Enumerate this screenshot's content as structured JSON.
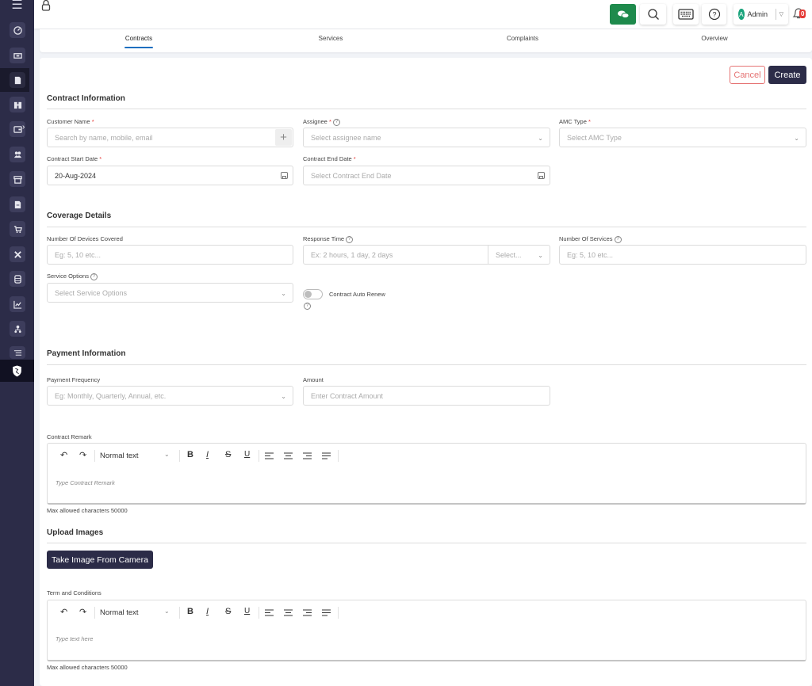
{
  "sidebar": {
    "menu_icon": "hamburger-icon",
    "items": [
      {
        "name": "dashboard",
        "icon": "gauge-icon"
      },
      {
        "name": "tickets",
        "icon": "ticket-icon"
      },
      {
        "name": "contracts",
        "icon": "document-icon",
        "active": true
      },
      {
        "name": "binoculars",
        "icon": "binoculars-icon"
      },
      {
        "name": "wallet",
        "icon": "wallet-icon",
        "has_submenu": true
      },
      {
        "name": "customers",
        "icon": "users-icon"
      },
      {
        "name": "store",
        "icon": "store-icon"
      },
      {
        "name": "invoices",
        "icon": "invoice-icon"
      },
      {
        "name": "cart",
        "icon": "cart-icon"
      },
      {
        "name": "tools",
        "icon": "tools-icon"
      },
      {
        "name": "database",
        "icon": "database-icon"
      },
      {
        "name": "reports",
        "icon": "chart-icon"
      },
      {
        "name": "hierarchy",
        "icon": "org-icon"
      },
      {
        "name": "settings-list",
        "icon": "list-icon"
      }
    ],
    "bottom_icon": "shield-icon"
  },
  "topbar": {
    "lock_icon": "lock-icon",
    "user_name": "Admin",
    "user_initial": "A",
    "notification_count": "0"
  },
  "tabs": [
    {
      "label": "Contracts",
      "active": true
    },
    {
      "label": "Services"
    },
    {
      "label": "Complaints"
    },
    {
      "label": "Overview"
    }
  ],
  "actions": {
    "cancel": "Cancel",
    "create": "Create"
  },
  "contract_info": {
    "title": "Contract Information",
    "customer_label": "Customer Name",
    "customer_placeholder": "Search by name, mobile, email",
    "assignee_label": "Assignee",
    "assignee_placeholder": "Select assignee name",
    "amc_label": "AMC Type",
    "amc_placeholder": "Select AMC Type",
    "start_label": "Contract Start Date",
    "start_value": "20-Aug-2024",
    "end_label": "Contract End Date",
    "end_placeholder": "Select Contract End Date",
    "required_mark": "*"
  },
  "coverage": {
    "title": "Coverage Details",
    "devices_label": "Number Of Devices Covered",
    "devices_placeholder": "Eg: 5, 10 etc...",
    "response_label": "Response Time",
    "response_placeholder": "Ex: 2 hours, 1 day, 2 days",
    "response_unit_placeholder": "Select...",
    "services_label": "Number Of Services",
    "services_placeholder": "Eg: 5, 10 etc...",
    "options_label": "Service Options",
    "options_placeholder": "Select Service Options",
    "auto_renew_label": "Contract Auto Renew",
    "auto_renew_on": false
  },
  "payment": {
    "title": "Payment Information",
    "frequency_label": "Payment Frequency",
    "frequency_placeholder": "Eg: Monthly, Quarterly, Annual, etc.",
    "amount_label": "Amount",
    "amount_placeholder": "Enter Contract Amount"
  },
  "remark": {
    "label": "Contract Remark",
    "text_style": "Normal text",
    "placeholder": "Type Contract Remark",
    "max_chars": "Max allowed characters 50000"
  },
  "upload": {
    "title": "Upload Images",
    "camera_button": "Take Image From Camera"
  },
  "terms": {
    "label": "Term and Conditions",
    "text_style": "Normal text",
    "placeholder": "Type text here",
    "max_chars": "Max allowed characters 50000"
  },
  "editor_tools": {
    "bold": "B",
    "italic": "I",
    "strike": "S",
    "underline": "U",
    "undo": "↶",
    "redo": "↷",
    "chevron": "⌄",
    "question": "?"
  }
}
